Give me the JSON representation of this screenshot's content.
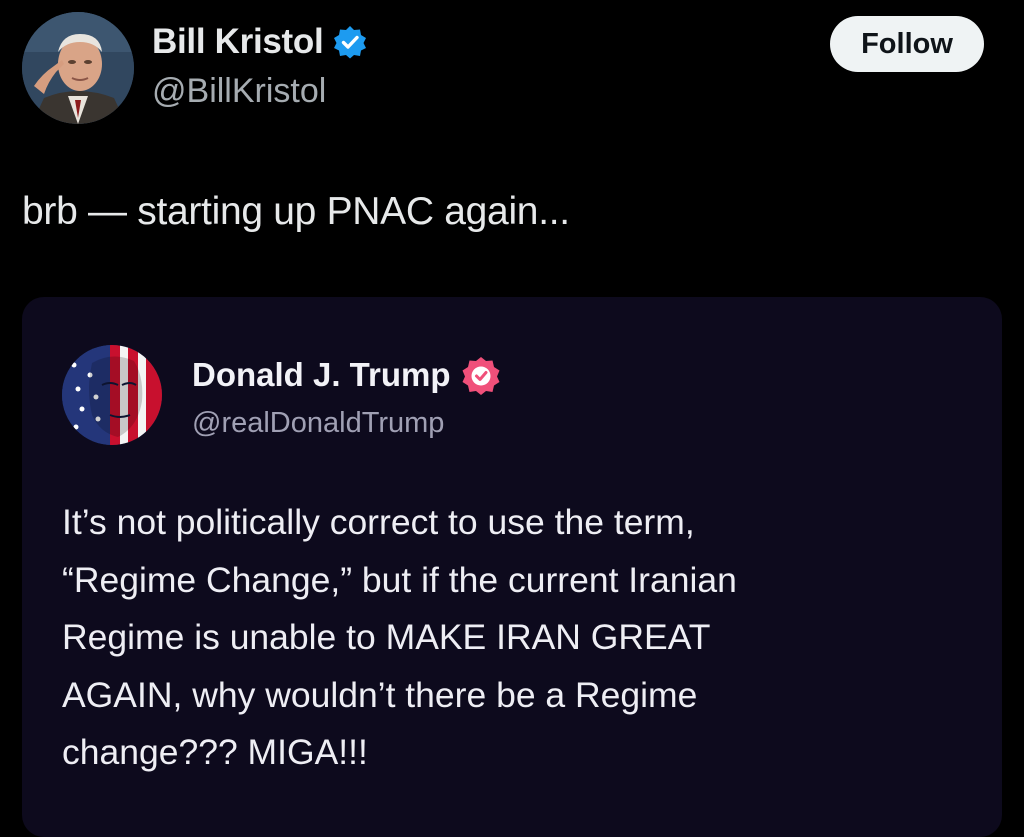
{
  "post": {
    "author": {
      "name": "Bill Kristol",
      "handle": "@BillKristol",
      "avatar_icon": "profile-photo-icon",
      "verified_icon": "blue-verified-badge-icon"
    },
    "follow_label": "Follow",
    "text": "brb — starting up PNAC again..."
  },
  "quoted_post": {
    "author": {
      "name": "Donald J. Trump",
      "handle": "@realDonaldTrump",
      "avatar_icon": "flag-portrait-avatar-icon",
      "verified_icon": "pink-verified-badge-icon"
    },
    "lines": [
      "It’s not politically correct to use the term,",
      "“Regime Change,” but if the current Iranian",
      "Regime is unable to MAKE IRAN GREAT",
      "AGAIN, why wouldn’t there be a Regime",
      "change??? MIGA!!!"
    ]
  },
  "colors": {
    "background": "#000000",
    "card_background": "#0d0a1d",
    "verified_blue": "#1d9bf0",
    "verified_pink": "#f0507a",
    "follow_bg": "#eff3f4"
  }
}
